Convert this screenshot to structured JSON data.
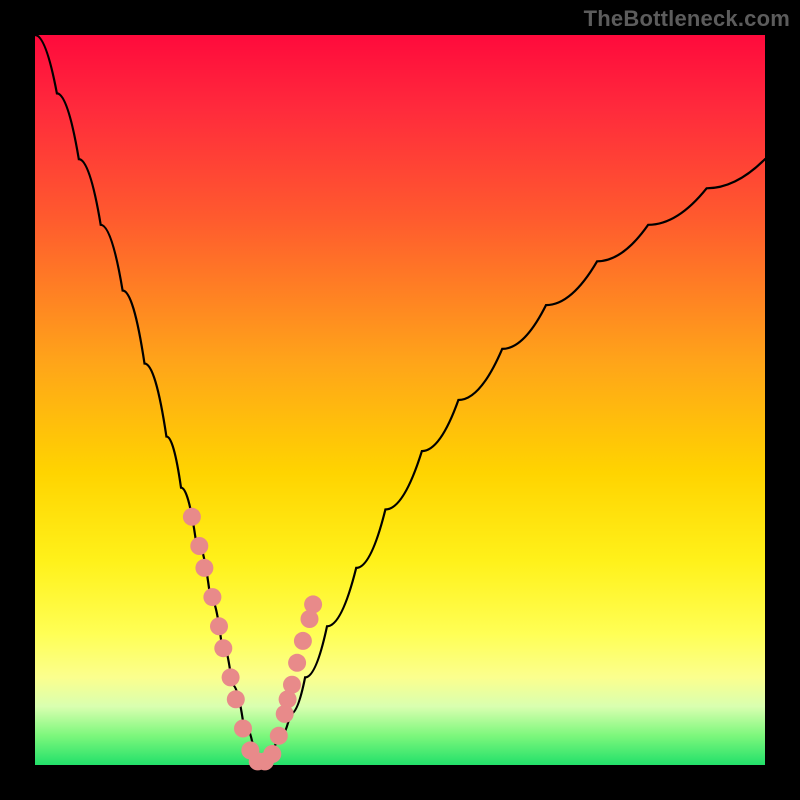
{
  "watermark": "TheBottleneck.com",
  "chart_data": {
    "type": "line",
    "title": "",
    "xlabel": "",
    "ylabel": "",
    "xlim": [
      0,
      100
    ],
    "ylim": [
      0,
      100
    ],
    "grid": false,
    "legend": false,
    "series": [
      {
        "name": "left-branch",
        "x": [
          0,
          3,
          6,
          9,
          12,
          15,
          18,
          20,
          22,
          24,
          25.5,
          27,
          28.5,
          30,
          31
        ],
        "y": [
          100,
          92,
          83,
          74,
          65,
          55,
          45,
          38,
          31,
          23,
          17,
          11,
          6,
          2,
          0
        ]
      },
      {
        "name": "right-branch",
        "x": [
          31,
          33,
          35,
          37,
          40,
          44,
          48,
          53,
          58,
          64,
          70,
          77,
          84,
          92,
          100
        ],
        "y": [
          0,
          3,
          7,
          12,
          19,
          27,
          35,
          43,
          50,
          57,
          63,
          69,
          74,
          79,
          83
        ]
      }
    ],
    "points": {
      "name": "markers",
      "x": [
        21.5,
        22.5,
        23.2,
        24.3,
        25.2,
        25.8,
        26.8,
        27.5,
        28.5,
        29.5,
        30.5,
        31.5,
        32.5,
        33.4,
        34.2,
        34.6,
        35.2,
        35.9,
        36.7,
        37.6,
        38.1
      ],
      "y": [
        34,
        30,
        27,
        23,
        19,
        16,
        12,
        9,
        5,
        2,
        0.5,
        0.5,
        1.5,
        4,
        7,
        9,
        11,
        14,
        17,
        20,
        22
      ]
    },
    "background_gradient": {
      "top_color": "#ff0a3c",
      "bottom_color": "#22e06a"
    }
  }
}
